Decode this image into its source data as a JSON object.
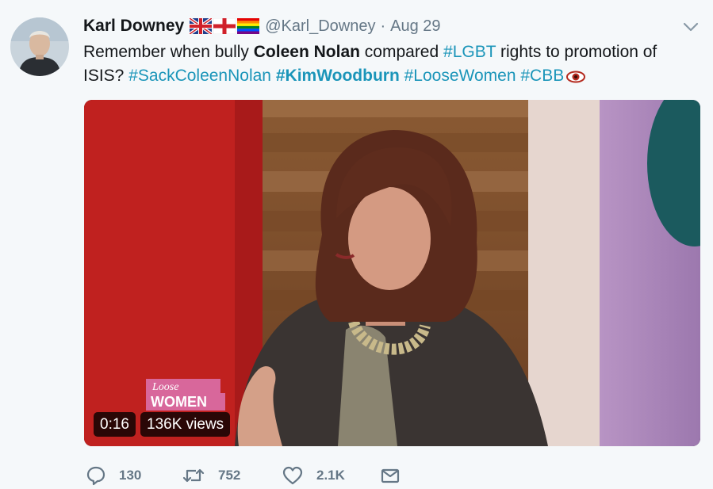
{
  "tweet": {
    "display_name": "Karl Downey",
    "handle": "@Karl_Downey",
    "separator": "·",
    "time": "Aug 29",
    "text": {
      "p1": "Remember when bully ",
      "bold1": "Coleen Nolan",
      "p2": " compared ",
      "tag1": "#LGBT",
      "p3": " rights to promotion of ISIS? ",
      "tag2": "#SackColeenNolan",
      "p4": " ",
      "tag3": "#KimWoodburn",
      "p5": " ",
      "tag4": "#LooseWomen",
      "p6": " ",
      "tag5": "#CBB"
    },
    "flag_icons": [
      "uk-flag-icon",
      "england-flag-icon",
      "rainbow-flag-icon"
    ]
  },
  "video": {
    "duration": "0:16",
    "views": "136K views",
    "logo_line1": "Loose",
    "logo_line2": "WOMEN"
  },
  "actions": {
    "reply_count": "130",
    "retweet_count": "752",
    "like_count": "2.1K"
  },
  "colors": {
    "link": "#1b95b9",
    "muted": "#657786",
    "background": "#f5f8fa"
  }
}
